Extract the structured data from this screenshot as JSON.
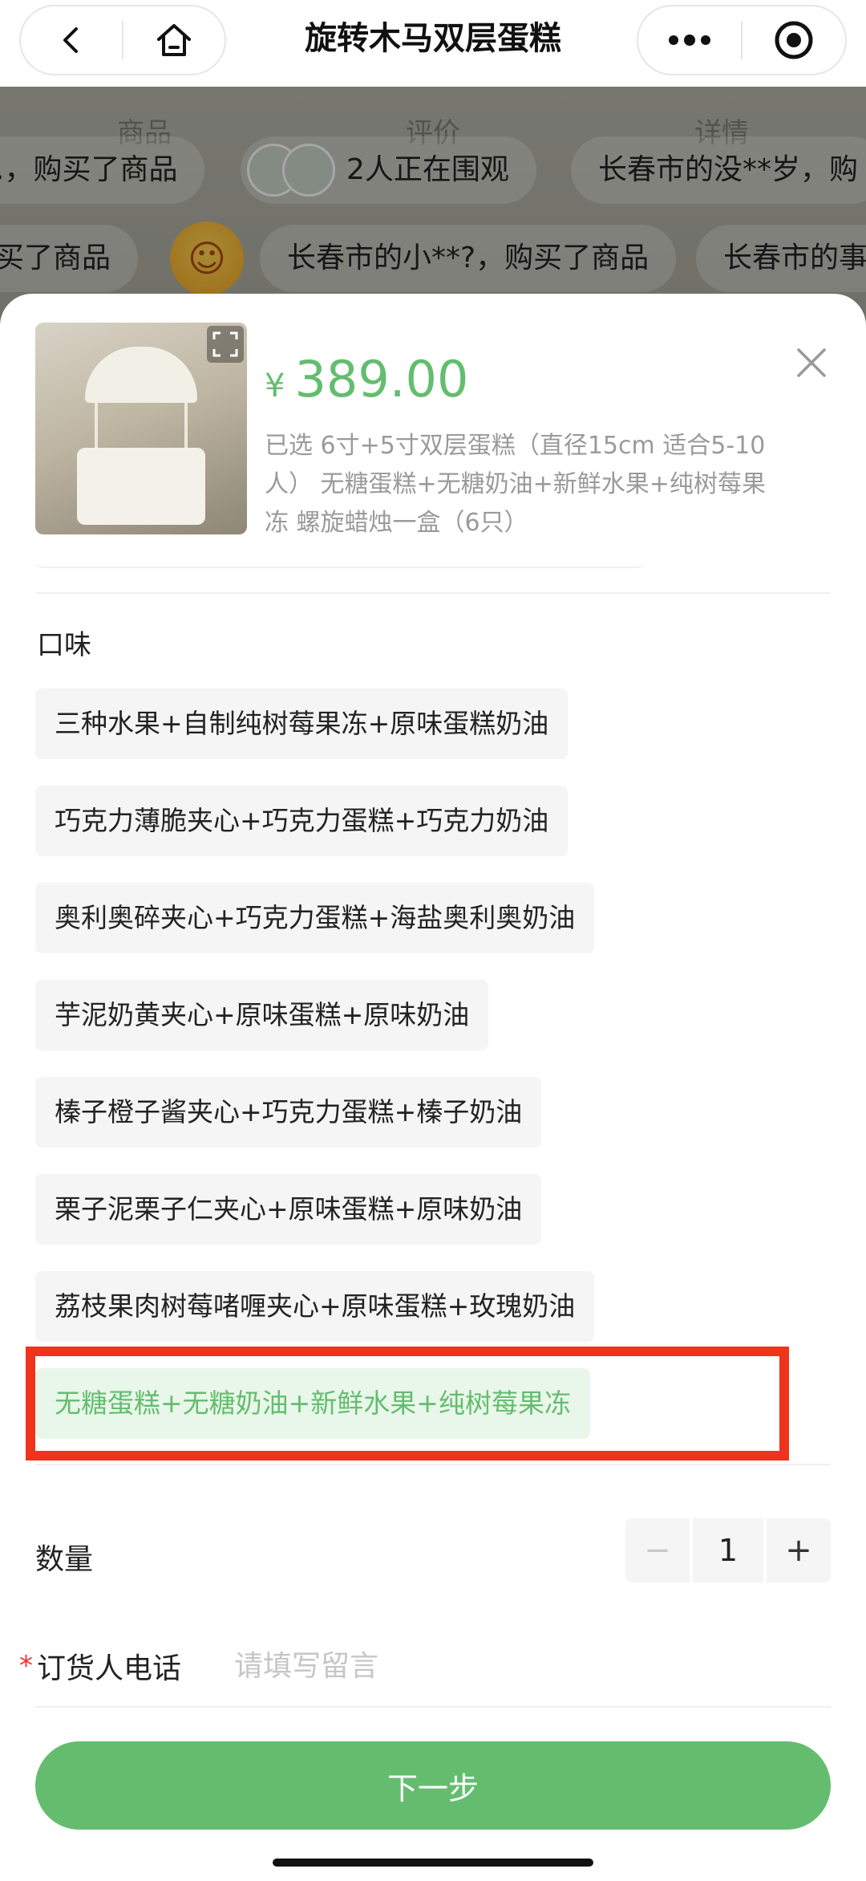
{
  "nav": {
    "title": "旋转木马双层蛋糕",
    "back_icon": "chevron-left-icon",
    "home_icon": "home-icon",
    "more_icon": "more-dots-icon",
    "target_icon": "record-icon"
  },
  "background_page": {
    "tabs": [
      "商品",
      "评价",
      "详情"
    ],
    "tickers": [
      {
        "text": ".，购买了商品"
      },
      {
        "text": "2人正在围观"
      },
      {
        "text": "长春市的没**岁，购"
      },
      {
        "text": "买了商品"
      },
      {
        "text": "长春市的小**?，购买了商品"
      },
      {
        "text": "长春市的事"
      }
    ]
  },
  "sheet": {
    "price_symbol": "¥",
    "price": "389.00",
    "selected_summary": "已选 6寸+5寸双层蛋糕（直径15cm 适合5-10人） 无糖蛋糕+无糖奶油+新鲜水果+纯树莓果冻 螺旋蜡烛一盒（6只）",
    "flavor_label": "口味",
    "flavors": [
      "三种水果+自制纯树莓果冻+原味蛋糕奶油",
      "巧克力薄脆夹心+巧克力蛋糕+巧克力奶油",
      "奥利奥碎夹心+巧克力蛋糕+海盐奥利奥奶油",
      "芋泥奶黄夹心+原味蛋糕+原味奶油",
      "榛子橙子酱夹心+巧克力蛋糕+榛子奶油",
      "栗子泥栗子仁夹心+原味蛋糕+原味奶油",
      "荔枝果肉树莓啫喱夹心+原味蛋糕+玫瑰奶油",
      "无糖蛋糕+无糖奶油+新鲜水果+纯树莓果冻"
    ],
    "selected_flavor_index": 7,
    "quantity_label": "数量",
    "quantity": "1",
    "minus": "−",
    "plus": "+",
    "phone_required_mark": "*",
    "phone_label": "订货人电话",
    "phone_placeholder": "请填写留言",
    "next_button": "下一步"
  },
  "colors": {
    "accent_green": "#64bd6f",
    "highlight_red": "#f0331b"
  }
}
